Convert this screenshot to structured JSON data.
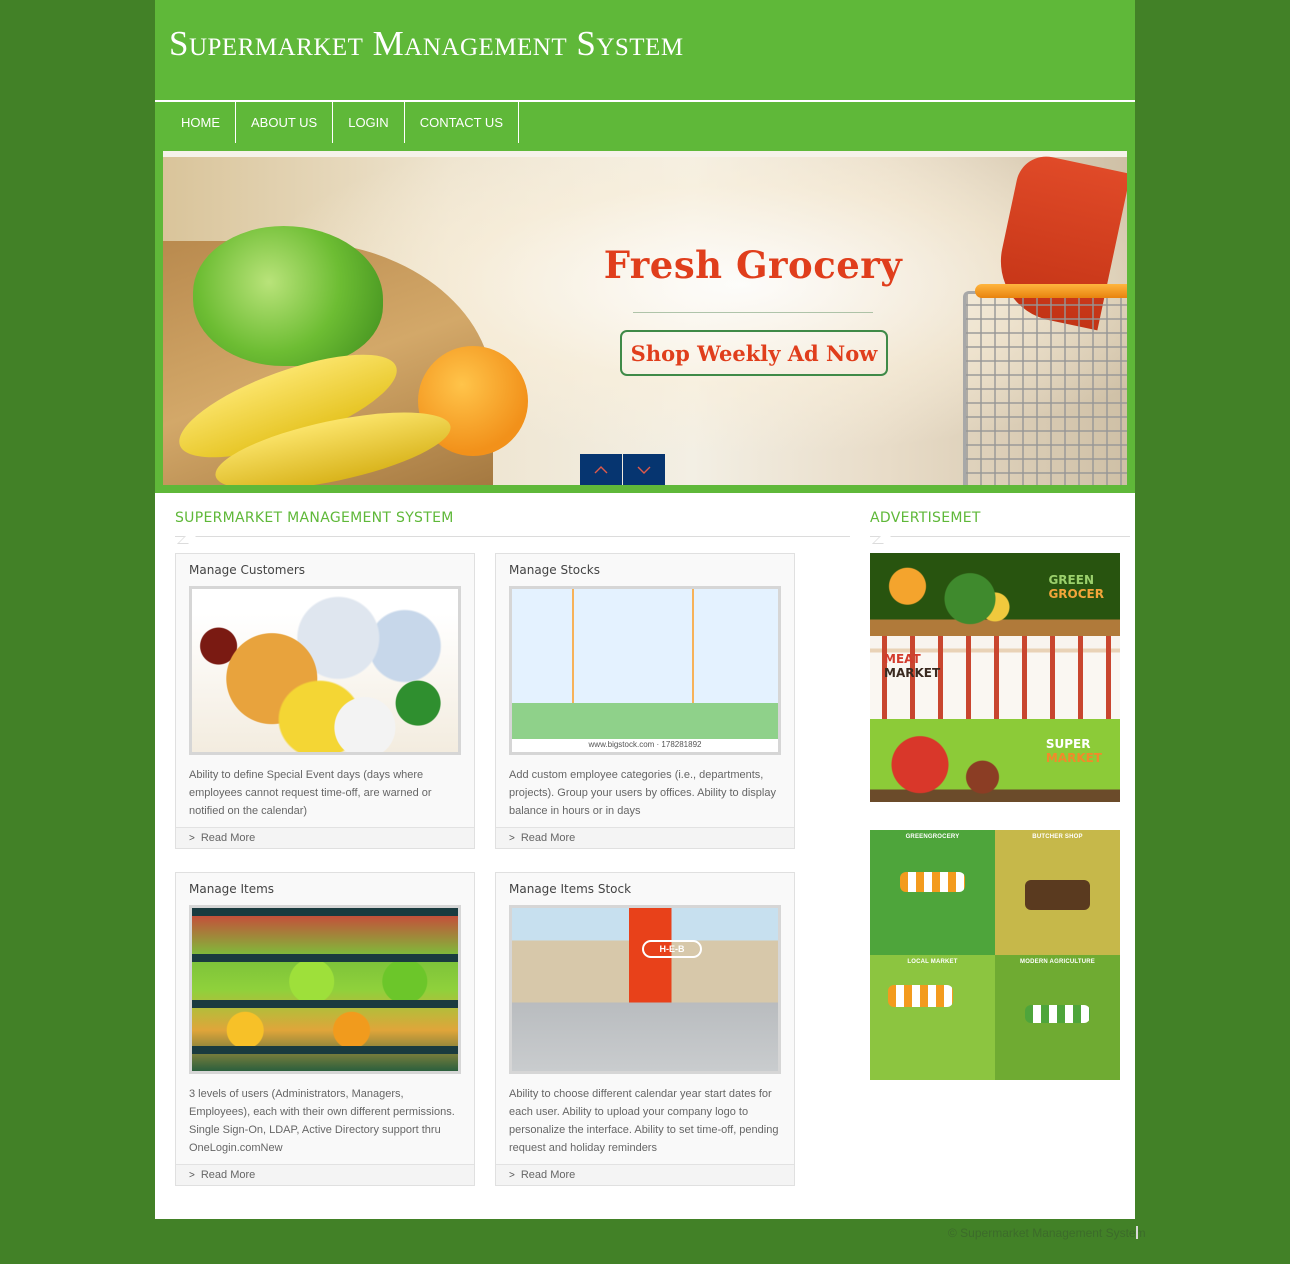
{
  "site": {
    "title": "Supermarket Management System"
  },
  "nav": {
    "items": [
      {
        "label": "HOME"
      },
      {
        "label": "ABOUT US"
      },
      {
        "label": "LOGIN"
      },
      {
        "label": "CONTACT US"
      }
    ]
  },
  "slider": {
    "headline": "Fresh Grocery",
    "cta_label": "Shop Weekly Ad Now",
    "controls": {
      "prev_icon": "chevron-up-icon",
      "next_icon": "chevron-down-icon"
    }
  },
  "main": {
    "section_title": "SUPERMARKET MANAGEMENT SYSTEM",
    "cards": [
      {
        "title": "Manage Customers",
        "image": "grocery-products-photo",
        "text": "Ability to define Special Event days (days where employees cannot request time-off, are warned or notified on the calendar)",
        "read_more": "Read More"
      },
      {
        "title": "Manage Stocks",
        "image": "store-shoppers-illustration",
        "image_watermark": "www.bigstock.com · 178281892",
        "text": "Add custom employee categories (i.e., departments, projects). Group your users by offices. Ability to display balance in hours or in days",
        "read_more": "Read More"
      },
      {
        "title": "Manage Items",
        "image": "produce-shelves-photo",
        "text": "3 levels of users (Administrators, Managers, Employees), each with their own different permissions. Single Sign-On, LDAP, Active Directory support thru OneLogin.comNew",
        "read_more": "Read More"
      },
      {
        "title": "Manage Items Stock",
        "image": "heb-storefront-photo",
        "image_sign": "H-E-B",
        "text": "Ability to choose different calendar year start dates for each user. Ability to upload your company logo to personalize the interface. Ability to set time-off, pending request and holiday reminders",
        "read_more": "Read More"
      }
    ]
  },
  "sidebar": {
    "section_title": "ADVERTISEMET",
    "banners": [
      {
        "line1": "GREEN",
        "line2": "GROCER"
      },
      {
        "line1": "MEAT",
        "line2": "MARKET"
      },
      {
        "line1": "SUPER",
        "line2": "MARKET"
      }
    ],
    "tiles": [
      {
        "label": "GREENGROCERY"
      },
      {
        "label": "BUTCHER SHOP"
      },
      {
        "label": "LOCAL MARKET"
      },
      {
        "label": "MODERN AGRICULTURE"
      }
    ]
  },
  "footer": {
    "copyright": "© Supermarket Management System"
  }
}
